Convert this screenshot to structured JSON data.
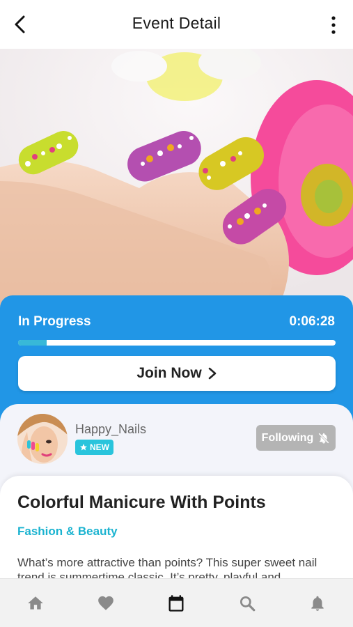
{
  "header": {
    "title": "Event Detail",
    "back_icon": "chevron-left-icon",
    "more_icon": "more-vertical-icon"
  },
  "progress": {
    "status": "In Progress",
    "elapsed": "0:06:28",
    "percent": 9,
    "button_label": "Join Now",
    "button_icon": "chevron-right-icon"
  },
  "host": {
    "name": "Happy_Nails",
    "badge": "NEW",
    "badge_icon": "star-icon",
    "follow_label": "Following",
    "follow_icon": "bell-off-icon"
  },
  "event": {
    "title": "Colorful Manicure With Points",
    "category": "Fashion & Beauty",
    "description": "What’s more attractive than points? This super sweet nail trend is summertime classic. It’s pretty, playful and"
  },
  "tabs": [
    {
      "icon": "home-icon",
      "active": false
    },
    {
      "icon": "heart-icon",
      "active": false
    },
    {
      "icon": "calendar-icon",
      "active": true
    },
    {
      "icon": "search-icon",
      "active": false
    },
    {
      "icon": "bell-icon",
      "active": false
    }
  ],
  "colors": {
    "primary": "#2196e6",
    "accent": "#29c4dc",
    "category": "#1ab3d0",
    "following_bg": "#b4b4b4"
  }
}
